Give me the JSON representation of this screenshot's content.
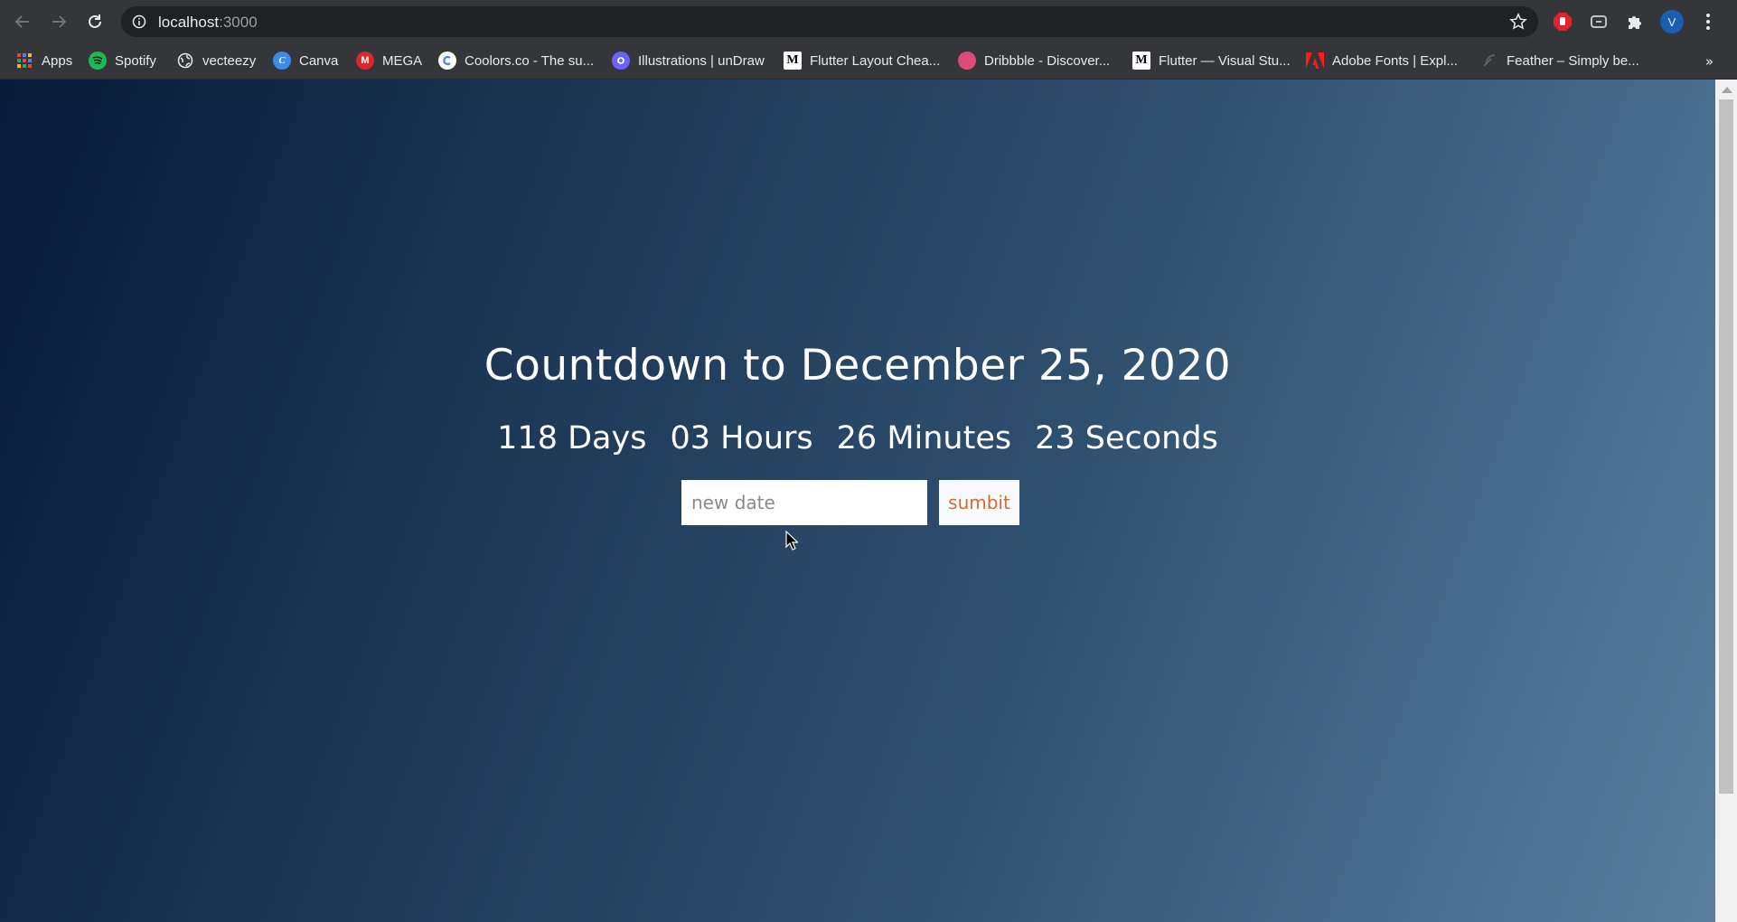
{
  "browser": {
    "url_host": "localhost",
    "url_port": ":3000",
    "avatar_letter": "V",
    "bookmarks": [
      {
        "label": "Apps",
        "icon": "apps-grid-icon"
      },
      {
        "label": "Spotify",
        "icon": "spotify-icon",
        "color": "#1db954"
      },
      {
        "label": "vecteezy",
        "icon": "globe-icon"
      },
      {
        "label": "Canva",
        "icon": "canva-icon",
        "letter": "C",
        "color": "#3b8ce8"
      },
      {
        "label": "MEGA",
        "icon": "mega-icon",
        "letter": "M",
        "color": "#d9272e"
      },
      {
        "label": "Coolors.co - The su...",
        "icon": "coolors-icon",
        "color": "#ffffff"
      },
      {
        "label": "Illustrations | unDraw",
        "icon": "undraw-icon",
        "color": "#6c63ff"
      },
      {
        "label": "Flutter Layout Chea...",
        "icon": "medium-icon",
        "letter": "M"
      },
      {
        "label": "Dribbble - Discover...",
        "icon": "dribbble-icon",
        "color": "#e04a78"
      },
      {
        "label": "Flutter — Visual Stu...",
        "icon": "medium-icon",
        "letter": "M"
      },
      {
        "label": "Adobe Fonts | Expl...",
        "icon": "adobe-icon",
        "color": "#ff0000"
      },
      {
        "label": "Feather – Simply be...",
        "icon": "feather-icon"
      }
    ],
    "overflow_label": "»"
  },
  "page": {
    "title": "Countdown to December 25, 2020",
    "countdown": {
      "days": "118 Days",
      "hours": "03 Hours",
      "minutes": "26 Minutes",
      "seconds": "23 Seconds"
    },
    "date_input": {
      "value": "",
      "placeholder": "new date"
    },
    "submit_label": "sumbit"
  },
  "colors": {
    "accent": "#d36b33",
    "gradient_start": "#061a3a",
    "gradient_end": "#5a7f9d"
  }
}
